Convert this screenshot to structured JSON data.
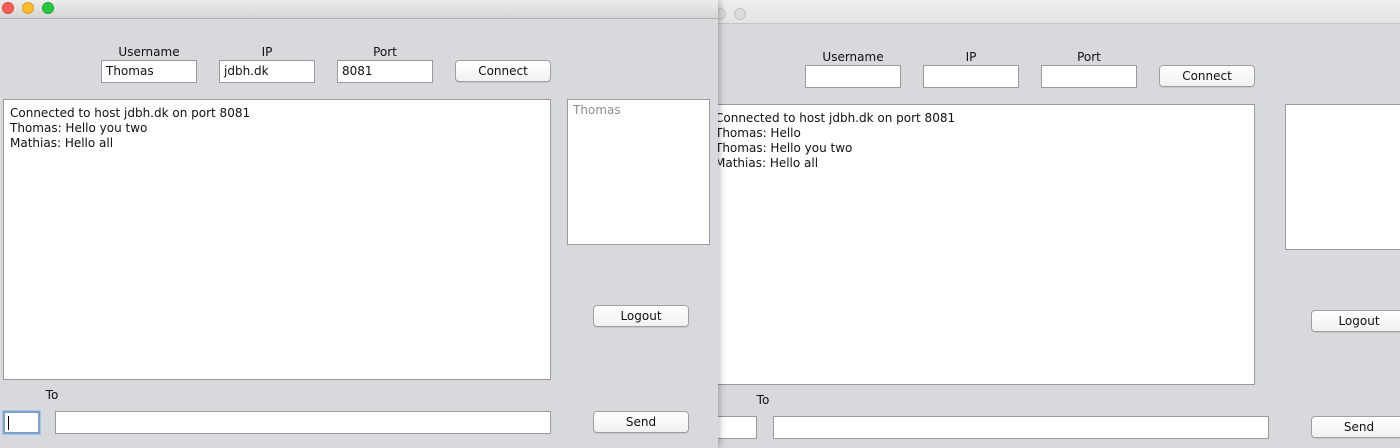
{
  "windows": {
    "front": {
      "form": {
        "username_label": "Username",
        "ip_label": "IP",
        "port_label": "Port",
        "username_value": "Thomas",
        "ip_value": "jdbh.dk",
        "port_value": "8081",
        "connect_label": "Connect"
      },
      "chat_lines": [
        "Connected to host jdbh.dk on port 8081",
        "Thomas: Hello you two",
        "Mathias: Hello all"
      ],
      "users": [
        "Thomas"
      ],
      "logout_label": "Logout",
      "to_label": "To",
      "to_value": "",
      "message_value": "",
      "send_label": "Send"
    },
    "back": {
      "form": {
        "username_label": "Username",
        "ip_label": "IP",
        "port_label": "Port",
        "username_value": "",
        "ip_value": "",
        "port_value": "",
        "connect_label": "Connect"
      },
      "chat_lines": [
        "Connected to host jdbh.dk on port 8081",
        "Thomas: Hello",
        "Thomas: Hello you two",
        "Mathias: Hello all"
      ],
      "users": [],
      "logout_label": "Logout",
      "to_label": "To",
      "to_value": "",
      "message_value": "",
      "send_label": "Send"
    }
  },
  "colors": {
    "window_bg": "#d8d9dc",
    "close": "#fc5f57",
    "minimize": "#fdbc2e",
    "maximize": "#28c840",
    "focus_ring": "#7da2ce",
    "placeholder_user": "#8e8e8e"
  },
  "icons": {
    "close": "close-icon",
    "minimize": "minimize-icon",
    "maximize": "maximize-icon"
  }
}
